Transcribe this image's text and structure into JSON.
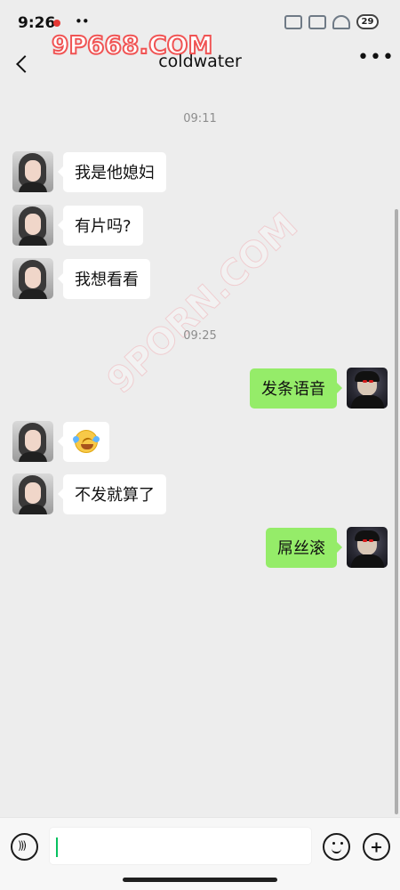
{
  "status": {
    "time": "9:26",
    "battery": "29"
  },
  "watermark": {
    "brand": "9P668.COM",
    "diagonal": "9PORN.COM"
  },
  "header": {
    "title": "coldwater"
  },
  "messages": [
    {
      "time": "09:11"
    },
    {
      "text": "我是他媳妇"
    },
    {
      "text": "有片吗?"
    },
    {
      "text": "我想看看"
    },
    {
      "time": "09:25"
    },
    {
      "text": "发条语音"
    },
    {
      "emoji": "tears-of-joy-emoji"
    },
    {
      "text": "不发就算了"
    },
    {
      "text": "屌丝滚"
    }
  ],
  "icons": {
    "voice": "voice-icon",
    "emoji": "emoji-icon",
    "plus": "plus-icon"
  },
  "colors": {
    "background": "#ededed",
    "sent_bubble": "#95ec69",
    "received_bubble": "#ffffff",
    "caret": "#07c160"
  }
}
